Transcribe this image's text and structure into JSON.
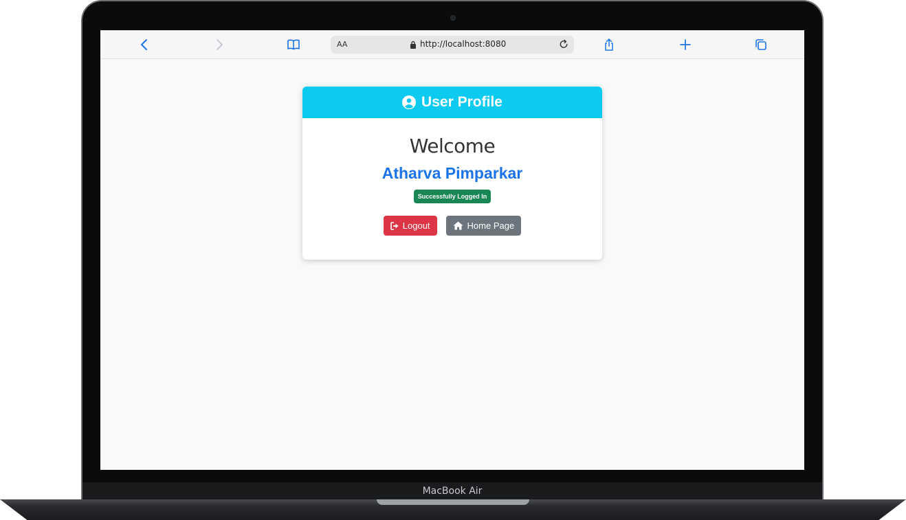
{
  "device": {
    "label": "MacBook Air"
  },
  "browser": {
    "text_size_label": "AA",
    "url": "http://localhost:8080"
  },
  "profile": {
    "header_title": "User Profile",
    "welcome": "Welcome",
    "user_name": "Atharva Pimparkar",
    "status_badge": "Successfully Logged In",
    "logout_label": "Logout",
    "home_label": "Home Page"
  },
  "colors": {
    "header_bg": "#0dcaf0",
    "name_color": "#1a73e8",
    "badge_bg": "#198754",
    "logout_bg": "#dc3545",
    "home_bg": "#6c757d"
  }
}
